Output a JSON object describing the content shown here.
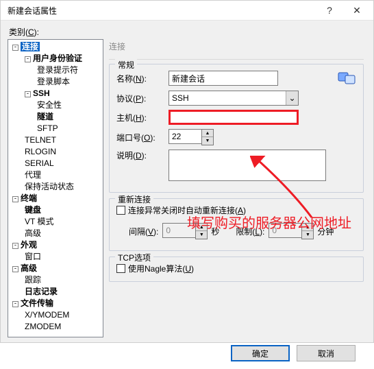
{
  "window": {
    "title": "新建会话属性"
  },
  "category_label_pre": "类别(",
  "category_label_key": "C",
  "category_label_post": "):",
  "tree": {
    "root": "连接",
    "items": {
      "auth": "用户身份验证",
      "auth_prompt": "登录提示符",
      "auth_script": "登录脚本",
      "ssh": "SSH",
      "ssh_security": "安全性",
      "ssh_tunnel": "隧道",
      "ssh_sftp": "SFTP",
      "telnet": "TELNET",
      "rlogin": "RLOGIN",
      "serial": "SERIAL",
      "proxy": "代理",
      "keepalive": "保持活动状态",
      "terminal": "终端",
      "term_keyboard": "键盘",
      "term_vt": "VT 模式",
      "term_adv": "高级",
      "appearance": "外观",
      "app_window": "窗口",
      "advanced": "高级",
      "adv_trace": "跟踪",
      "adv_log": "日志记录",
      "filetransfer": "文件传输",
      "ft_xy": "X/YMODEM",
      "ft_z": "ZMODEM"
    }
  },
  "panel": {
    "title": "连接",
    "general": {
      "legend": "常规",
      "name_lbl_pre": "名称(",
      "name_key": "N",
      "name_lbl_post": "):",
      "name_value": "新建会话",
      "proto_lbl_pre": "协议(",
      "proto_key": "P",
      "proto_lbl_post": "):",
      "proto_value": "SSH",
      "host_lbl_pre": "主机(",
      "host_key": "H",
      "host_lbl_post": "):",
      "host_value": "",
      "port_lbl_pre": "端口号(",
      "port_key": "O",
      "port_lbl_post": "):",
      "port_value": "22",
      "desc_lbl_pre": "说明(",
      "desc_key": "D",
      "desc_lbl_post": "):",
      "desc_value": ""
    },
    "reconnect": {
      "legend": "重新连接",
      "chk_pre": "连接异常关闭时自动重新连接(",
      "chk_key": "A",
      "chk_post": ")",
      "interval_pre": "间隔(",
      "interval_key": "V",
      "interval_post": "):",
      "interval_value": "0",
      "interval_unit": "秒",
      "limit_pre": "限制(",
      "limit_key": "L",
      "limit_post": "):",
      "limit_value": "0",
      "limit_unit": "分钟"
    },
    "tcp": {
      "legend": "TCP选项",
      "chk_pre": "使用Nagle算法(",
      "chk_key": "U",
      "chk_post": ")"
    }
  },
  "annotation": "填写购买的服务器公网地址",
  "buttons": {
    "ok": "确定",
    "cancel": "取消"
  },
  "sym": {
    "minus": "-",
    "plus": "+",
    "up": "▲",
    "down": "▼",
    "chev": "⌄",
    "help": "?",
    "close": "✕"
  }
}
